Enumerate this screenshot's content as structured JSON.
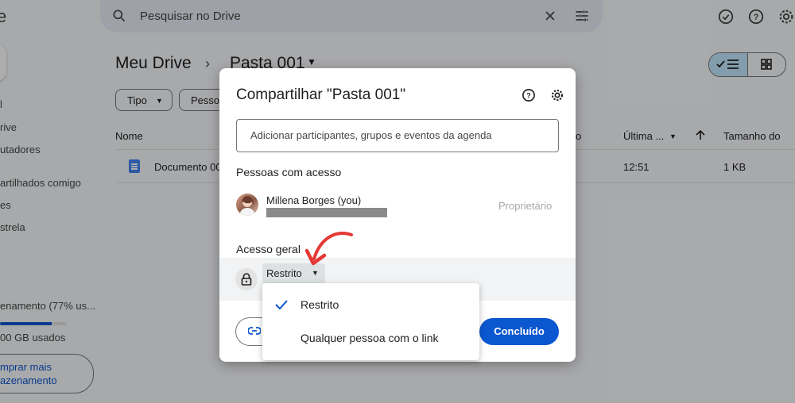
{
  "app": {
    "logo_fragment": "e",
    "search": {
      "placeholder": "Pesquisar no Drive"
    }
  },
  "sidebar": {
    "items": [
      "l",
      "rive",
      "utadores",
      "artilhados comigo",
      "es",
      "strela"
    ],
    "storage": {
      "label": "enamento (77% us...",
      "used": "00 GB usados",
      "percent": 77
    },
    "buy_button": "mprar mais\nazenamento"
  },
  "breadcrumb": {
    "root": "Meu Drive",
    "separator": "›",
    "current": "Pasta 001"
  },
  "filters": [
    "Tipo",
    "Pesso"
  ],
  "table": {
    "headers": {
      "name": "Nome",
      "owner_fragment": "o",
      "modified": "Última ...",
      "size": "Tamanho do"
    },
    "rows": [
      {
        "name": "Documento 00",
        "modified": "12:51",
        "size": "1 KB"
      }
    ]
  },
  "dialog": {
    "title": "Compartilhar \"Pasta 001\"",
    "add_placeholder": "Adicionar participantes, grupos e eventos da agenda",
    "people_section": "Pessoas com acesso",
    "person": {
      "name": "Millena Borges (you)",
      "role": "Proprietário"
    },
    "general_section": "Acesso geral",
    "access_value": "Restrito",
    "done_label": "Concluído"
  },
  "access_menu": {
    "options": [
      {
        "label": "Restrito",
        "selected": true
      },
      {
        "label": "Qualquer pessoa com o link",
        "selected": false
      }
    ]
  },
  "colors": {
    "accent": "#0b57d0",
    "annotation_arrow": "#e53935"
  }
}
